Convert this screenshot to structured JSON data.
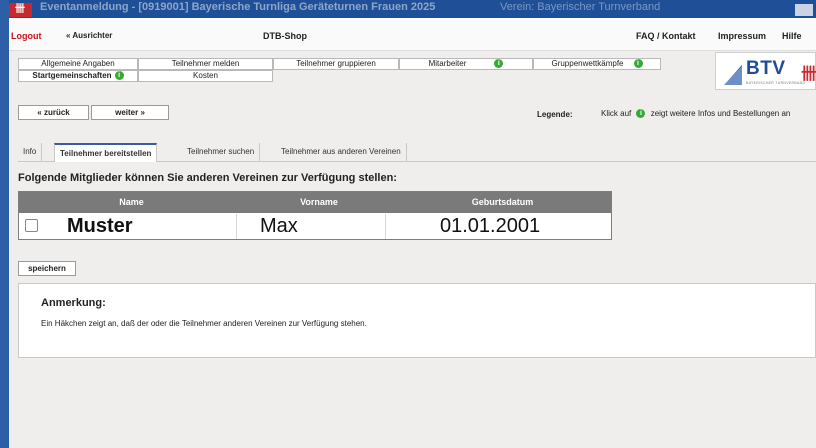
{
  "titlebar": {
    "logo": "卌",
    "text": "Eventanmeldung - [0919001] Bayerische Turnliga Geräteturnen Frauen 2025",
    "sub": "Verein: Bayerischer Turnverband"
  },
  "menubar": {
    "logout": "Logout",
    "ausrichter": "« Ausrichter",
    "shop": "DTB-Shop",
    "faq": "FAQ / Kontakt",
    "impressum": "Impressum",
    "hilfe": "Hilfe"
  },
  "tabs": {
    "allgemeine": "Allgemeine Angaben",
    "teilnehmer_melden": "Teilnehmer melden",
    "teilnehmer_gruppieren": "Teilnehmer gruppieren",
    "mitarbeiter": "Mitarbeiter",
    "gruppenwettkaempfe": "Gruppenwettkämpfe",
    "startgemeinschaften": "Startgemeinschaften",
    "kosten": "Kosten"
  },
  "logo": {
    "text": "BTV",
    "mark": "卌",
    "small": "BAYERISCHER TURNVERBAND"
  },
  "nav": {
    "zurueck": "« zurück",
    "weiter": "weiter »"
  },
  "legend": {
    "label": "Legende:",
    "text_before": "Klick auf",
    "text_after": "zeigt weitere Infos und Bestellungen an"
  },
  "subtabs": {
    "info": "Info",
    "bereitstellen": "Teilnehmer bereitstellen",
    "suchen": "Teilnehmer suchen",
    "andere": "Teilnehmer aus anderen Vereinen"
  },
  "heading": "Folgende Mitglieder können Sie anderen Vereinen zur Verfügung stellen:",
  "table": {
    "headers": [
      "Name",
      "Vorname",
      "Geburtsdatum"
    ],
    "rows": [
      {
        "checked": false,
        "name": "Muster",
        "vorname": "Max",
        "geburtsdatum": "01.01.2001"
      }
    ]
  },
  "save": "speichern",
  "note": {
    "title": "Anmerkung:",
    "text": "Ein Häkchen zeigt an, daß der oder die Teilnehmer anderen Vereinen zur Verfügung stehen."
  },
  "colors": {
    "titlebar": "#1e4f97",
    "logout": "#c8121b",
    "info_icon": "#39a935",
    "table_header": "#7a7a7a"
  }
}
